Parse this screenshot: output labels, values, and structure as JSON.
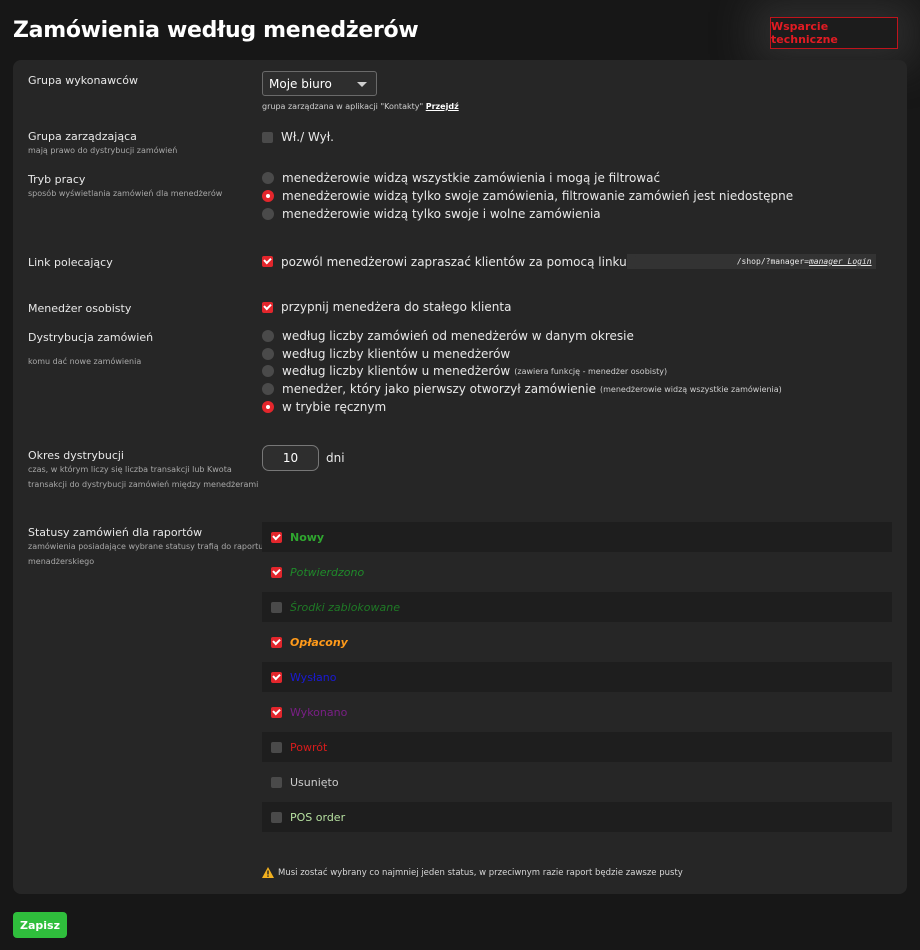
{
  "header": {
    "title": "Zamówienia według menedżerów",
    "support_button": "Wsparcie techniczne"
  },
  "group_executors": {
    "label": "Grupa wykonawców",
    "select_value": "Moje biuro",
    "hint": "grupa zarządzana w aplikacji \"Kontakty\"",
    "hint_link": "Przejdź"
  },
  "managing_group": {
    "label": "Grupa zarządzająca",
    "sub": "mają prawo do dystrybucji zamówień",
    "toggle_label": "Wł./ Wył.",
    "checked": false
  },
  "work_mode": {
    "label": "Tryb pracy",
    "sub": "sposób wyświetlania zamówień dla menedżerów",
    "options": [
      {
        "label": "menedżerowie widzą wszystkie zamówienia i mogą je filtrować",
        "selected": false
      },
      {
        "label": "menedżerowie widzą tylko swoje zamówienia, filtrowanie zamówień jest niedostępne",
        "selected": true
      },
      {
        "label": "menedżerowie widzą tylko swoje i wolne zamówienia",
        "selected": false
      }
    ]
  },
  "referral_link": {
    "label": "Link polecający",
    "checkbox_label": "pozwól menedżerowi zapraszać klientów za pomocą linku",
    "checked": true,
    "url_path": "/shop/?manager=",
    "url_param": "manager_Login"
  },
  "personal_manager": {
    "label": "Menedżer osobisty",
    "checkbox_label": "przypnij menedżera do stałego klienta",
    "checked": true
  },
  "distribution": {
    "label": "Dystrybucja zamówień",
    "sub": "komu dać nowe zamówienia",
    "options": [
      {
        "label": "według liczby zamówień od menedżerów w danym okresie",
        "note": "",
        "selected": false
      },
      {
        "label": "według liczby klientów u menedżerów",
        "note": "",
        "selected": false
      },
      {
        "label": "według liczby klientów u menedżerów",
        "note": "(zawiera funkcję - menedżer osobisty)",
        "selected": false
      },
      {
        "label": "menedżer, który jako pierwszy otworzył zamówienie",
        "note": "(menedżerowie widzą wszystkie zamówienia)",
        "selected": false
      },
      {
        "label": "w trybie ręcznym",
        "note": "",
        "selected": true
      }
    ]
  },
  "period": {
    "label": "Okres dystrybucji",
    "sub_line1": "czas, w którym liczy się liczba transakcji lub Kwota",
    "sub_line2": "transakcji do dystrybucji zamówień między menedżerami",
    "value": "10",
    "unit": "dni"
  },
  "report_statuses": {
    "label": "Statusy zamówień dla raportów",
    "sub_line1": "zamówienia posiadające wybrane statusy trafią do raportu",
    "sub_line2": "menadżerskiego",
    "items": [
      {
        "name": "Nowy",
        "checked": true,
        "color": "#2fa52f",
        "style": "bold"
      },
      {
        "name": "Potwierdzono",
        "checked": true,
        "color": "#1f8a2a",
        "style": "italic"
      },
      {
        "name": "Środki zablokowane",
        "checked": false,
        "color": "#1f7a26",
        "style": "italic"
      },
      {
        "name": "Opłacony",
        "checked": true,
        "color": "#ff9a1a",
        "style": "bold-italic"
      },
      {
        "name": "Wysłano",
        "checked": true,
        "color": "#1a1ad6",
        "style": "normal"
      },
      {
        "name": "Wykonano",
        "checked": true,
        "color": "#7a1f86",
        "style": "normal"
      },
      {
        "name": "Powrót",
        "checked": false,
        "color": "#d81c1c",
        "style": "normal"
      },
      {
        "name": "Usunięto",
        "checked": false,
        "color": "#cccccc",
        "style": "normal"
      },
      {
        "name": "POS order",
        "checked": false,
        "color": "#b6e0a0",
        "style": "normal"
      }
    ],
    "warning": "Musi zostać wybrany co najmniej jeden status, w przeciwnym razie raport będzie zawsze pusty"
  },
  "footer": {
    "save_label": "Zapisz"
  },
  "colors": {
    "accent_red": "#e3262c",
    "save_green": "#2fbe3c",
    "panel_bg": "#262626",
    "page_bg": "#171717"
  },
  "icons": {
    "warning": "warning-triangle-icon",
    "dropdown": "chevron-down-icon"
  }
}
